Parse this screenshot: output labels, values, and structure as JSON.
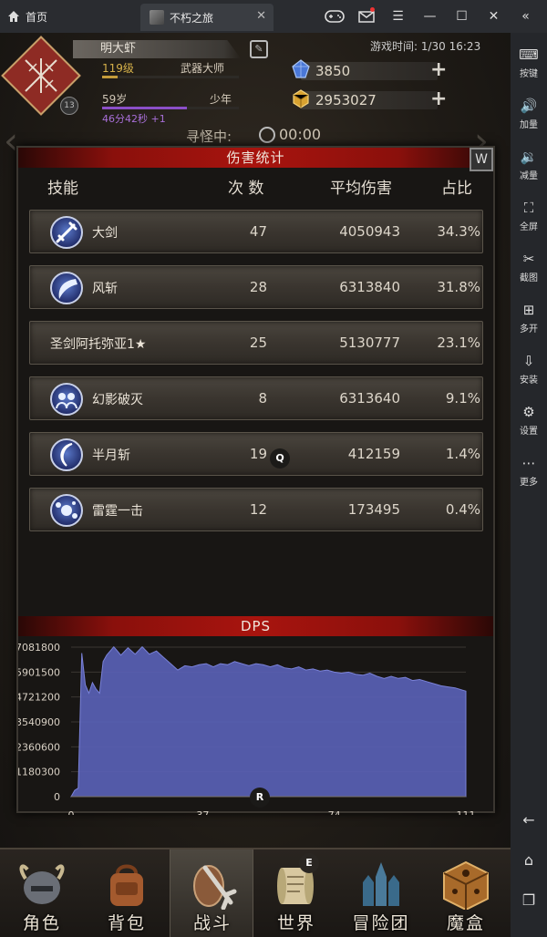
{
  "emulator": {
    "home_tab": "首页",
    "game_tab": "不朽之旅",
    "sidebar": [
      {
        "label": "按键",
        "icon": "keyboard-icon"
      },
      {
        "label": "加量",
        "icon": "volume-up-icon"
      },
      {
        "label": "减量",
        "icon": "volume-down-icon"
      },
      {
        "label": "全屏",
        "icon": "fullscreen-icon"
      },
      {
        "label": "截图",
        "icon": "scissors-icon"
      },
      {
        "label": "多开",
        "icon": "multi-instance-icon"
      },
      {
        "label": "安装",
        "icon": "apk-install-icon"
      },
      {
        "label": "设置",
        "icon": "settings-gear-icon"
      },
      {
        "label": "更多",
        "icon": "more-icon"
      }
    ],
    "accent": "#e33333"
  },
  "player": {
    "name": "明大虾",
    "level": "119级",
    "class": "武器大师",
    "age": "59岁",
    "stage": "少年",
    "timer": "46分42秒 +1",
    "avatar_badge": "13",
    "exp_fraction": 0.11,
    "life_fraction": 0.62
  },
  "game_time": "游戏时间: 1/30 16:23",
  "resources": {
    "gems": "3850",
    "gold": "2953027"
  },
  "hunt": {
    "label": "寻怪中:",
    "time": "00:00"
  },
  "damage_panel": {
    "title": "伤害统计",
    "close_label": "W",
    "headers": {
      "skill": "技能",
      "count": "次 数",
      "avg": "平均伤害",
      "pct": "占比"
    },
    "rows": [
      {
        "name": "大剑",
        "count": "47",
        "avg": "4050943",
        "pct": "34.3%",
        "icon": "sword-skill-icon"
      },
      {
        "name": "风斩",
        "count": "28",
        "avg": "6313840",
        "pct": "31.8%",
        "icon": "wind-slash-icon"
      },
      {
        "name": "圣剑阿托弥亚1★",
        "count": "25",
        "avg": "5130777",
        "pct": "23.1%",
        "icon": ""
      },
      {
        "name": "幻影破灭",
        "count": "8",
        "avg": "6313640",
        "pct": "9.1%",
        "icon": "phantom-icon"
      },
      {
        "name": "半月斩",
        "count": "19",
        "avg": "412159",
        "pct": "1.4%",
        "icon": "half-moon-slash-icon"
      },
      {
        "name": "雷霆一击",
        "count": "12",
        "avg": "173495",
        "pct": "0.4%",
        "icon": "thunder-strike-icon"
      }
    ]
  },
  "markers": {
    "q": "Q",
    "r": "R",
    "e": "E"
  },
  "chart_data": {
    "type": "area",
    "title": "DPS",
    "xlabel": "",
    "ylabel": "",
    "xlim": [
      0,
      111
    ],
    "ylim": [
      0,
      7081800
    ],
    "x_ticks": [
      "0",
      "37",
      "74",
      "111"
    ],
    "y_ticks": [
      "7081800",
      "5901500",
      "4721200",
      "3540900",
      "2360600",
      "1180300",
      "0"
    ],
    "grid": true,
    "color": "#5a62b8",
    "series": [
      {
        "x": [
          0,
          1,
          2,
          3,
          4,
          5,
          6,
          7,
          8,
          9,
          10,
          12,
          14,
          16,
          18,
          20,
          22,
          24,
          26,
          28,
          30,
          32,
          34,
          36,
          38,
          40,
          42,
          44,
          46,
          48,
          50,
          52,
          54,
          56,
          58,
          60,
          62,
          64,
          66,
          68,
          70,
          72,
          74,
          76,
          78,
          80,
          82,
          84,
          86,
          88,
          90,
          92,
          94,
          96,
          98,
          100,
          102,
          104,
          106,
          108,
          110,
          111
        ],
        "values": [
          0,
          300000,
          400000,
          6800000,
          5300000,
          4900000,
          5400000,
          5100000,
          4900000,
          6400000,
          6700000,
          7100000,
          6700000,
          7050000,
          6750000,
          7100000,
          6750000,
          6900000,
          6600000,
          6300000,
          6000000,
          6200000,
          6150000,
          6250000,
          6300000,
          6150000,
          6300000,
          6250000,
          6400000,
          6300000,
          6200000,
          6300000,
          6250000,
          6150000,
          6250000,
          6100000,
          6050000,
          6150000,
          6000000,
          6050000,
          5950000,
          6000000,
          5900000,
          5850000,
          5900000,
          5800000,
          5750000,
          5850000,
          5700000,
          5600000,
          5700000,
          5600000,
          5650000,
          5500000,
          5550000,
          5450000,
          5350000,
          5250000,
          5200000,
          5150000,
          5050000,
          5000000
        ]
      }
    ]
  },
  "bottom_nav": [
    {
      "label": "角色",
      "active": false
    },
    {
      "label": "背包",
      "active": false
    },
    {
      "label": "战斗",
      "active": true
    },
    {
      "label": "世界",
      "active": false
    },
    {
      "label": "冒险团",
      "active": false
    },
    {
      "label": "魔盒",
      "active": false
    }
  ]
}
